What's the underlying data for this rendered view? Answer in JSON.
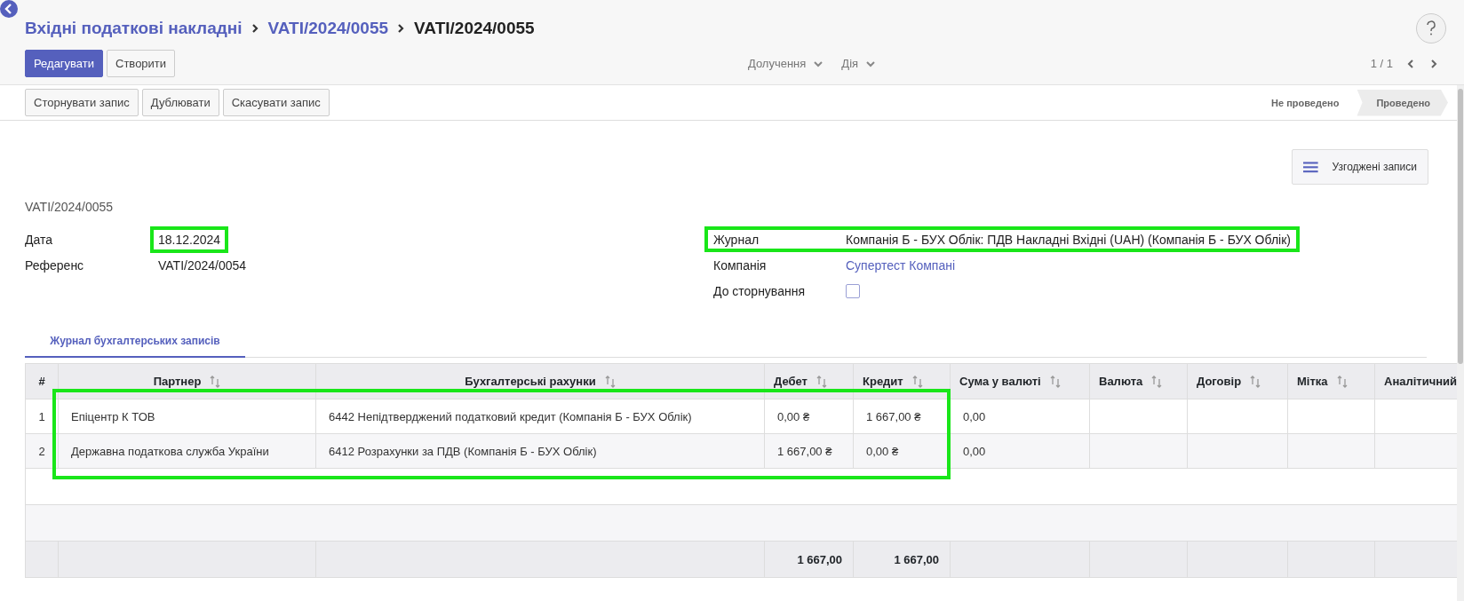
{
  "breadcrumb": [
    {
      "label": "Вхідні податкові накладні",
      "current": false
    },
    {
      "label": "VATI/2024/0055",
      "current": false
    },
    {
      "label": "VATI/2024/0055",
      "current": true
    }
  ],
  "toolbar": {
    "buttons": [
      {
        "label": "Редагувати",
        "primary": true
      },
      {
        "label": "Створити",
        "primary": false
      }
    ],
    "dropdowns": [
      "Долучення",
      "Дія"
    ],
    "pager": "1 / 1"
  },
  "actions": [
    "Сторнувати запис",
    "Дублювати",
    "Скасувати запис"
  ],
  "status_steps": [
    {
      "label": "Не проведено",
      "selected": false
    },
    {
      "label": "Проведено",
      "selected": true
    }
  ],
  "smart_button": {
    "label": "Узгоджені записи"
  },
  "record_name": "VATI/2024/0055",
  "fields_left": [
    {
      "label": "Дата",
      "value": "18.12.2024",
      "highlighted": true
    },
    {
      "label": "Референс",
      "value": "VATI/2024/0054",
      "highlighted": false
    }
  ],
  "fields_right": [
    {
      "kind": "text",
      "label": "Журнал",
      "value": "Компанія Б - БУХ Облік: ПДВ Накладні Вхідні (UAH) (Компанія Б - БУХ Облік)",
      "highlighted": true
    },
    {
      "kind": "link",
      "label": "Компанія",
      "value": "Супертест Компані",
      "highlighted": false
    },
    {
      "kind": "checkbox",
      "label": "До сторнування",
      "checked": false,
      "highlighted": false
    }
  ],
  "tabs": [
    {
      "label": "Журнал бухгалтерських записів",
      "selected": true
    }
  ],
  "table": {
    "highlighted": true,
    "columns": [
      "#",
      "Партнер",
      "Бухгалтерські рахунки",
      "Дебет",
      "Кредит",
      "Сума у валюті",
      "Валюта",
      "Договір",
      "Мітка",
      "Аналітичний"
    ],
    "rows": [
      {
        "number": "1",
        "partner": "Епіцентр К ТОВ",
        "account": "6442 Непідтверджений податковий кредит (Компанія Б - БУХ Облік)",
        "debit": "0,00 ₴",
        "credit": "1 667,00 ₴",
        "amount_currency": "0,00"
      },
      {
        "number": "2",
        "partner": "Державна податкова служба України",
        "account": "6412 Розрахунки за ПДВ (Компанія Б - БУХ Облік)",
        "debit": "1 667,00 ₴",
        "credit": "0,00 ₴",
        "amount_currency": "0,00"
      }
    ],
    "totals": {
      "debit": "1 667,00",
      "credit": "1 667,00"
    }
  }
}
